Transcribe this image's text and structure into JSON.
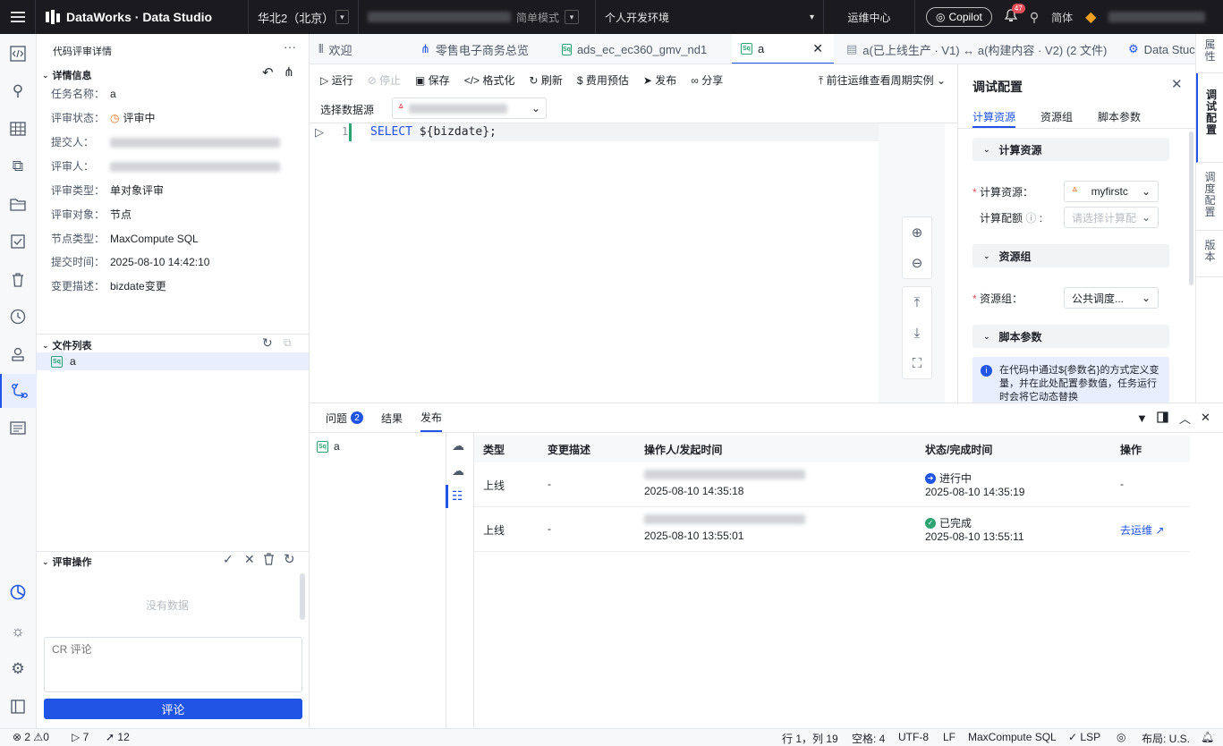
{
  "topbar": {
    "brand": "DataWorks · Data Studio",
    "region": "华北2（北京）",
    "mode": "简单模式",
    "env": "个人开发环境",
    "ops_center": "运维中心",
    "copilot": "Copilot",
    "notif_count": "47",
    "lang": "简体"
  },
  "review": {
    "title": "代码评审详情",
    "section_info": "详情信息",
    "fields": [
      {
        "k": "任务名称：",
        "v": "a"
      },
      {
        "k": "评审状态：",
        "v": "评审中"
      },
      {
        "k": "提交人：",
        "v": ""
      },
      {
        "k": "评审人：",
        "v": ""
      },
      {
        "k": "评审类型：",
        "v": "单对象评审"
      },
      {
        "k": "评审对象：",
        "v": "节点"
      },
      {
        "k": "节点类型：",
        "v": "MaxCompute SQL"
      },
      {
        "k": "提交时间：",
        "v": "2025-08-10 14:42:10"
      },
      {
        "k": "变更描述：",
        "v": "bizdate变更"
      }
    ],
    "section_files": "文件列表",
    "file_name": "a",
    "section_ops": "评审操作",
    "no_data": "没有数据",
    "comment_placeholder": "CR 评论",
    "comment_btn": "评论"
  },
  "tabs": [
    {
      "label": "欢迎"
    },
    {
      "label": "零售电子商务总览"
    },
    {
      "label": "ads_ec_ec360_gmv_nd1"
    },
    {
      "label": "a"
    },
    {
      "label": "a(已上线生产 · V1) ↔ a(构建内容 · V2) (2 文件)"
    },
    {
      "label": "Data Stuc"
    }
  ],
  "toolbar": {
    "run": "运行",
    "stop": "停止",
    "save": "保存",
    "format": "格式化",
    "refresh": "刷新",
    "cost": "费用预估",
    "publish": "发布",
    "share": "分享",
    "goto_ops": "前往运维查看周期实例"
  },
  "datasource_label": "选择数据源",
  "editor": {
    "line_no": "1",
    "code_kw": "SELECT",
    "code_rest": " ${bizdate};"
  },
  "debug": {
    "title": "调试配置",
    "tabs": [
      "计算资源",
      "资源组",
      "脚本参数"
    ],
    "grp_compute": "计算资源",
    "compute_label": "计算资源：",
    "compute_value": "myfirstc",
    "quota_label": "计算配额",
    "quota_placeholder": "请选择计算配",
    "grp_resource": "资源组",
    "resource_label": "资源组：",
    "resource_value": "公共调度...",
    "grp_params": "脚本参数",
    "info": "在代码中通过${参数名}的方式定义变量，并在此处配置参数值，任务运行时会将它动态替换"
  },
  "side_tabs": [
    "属性",
    "调试配置",
    "调度配置",
    "版本"
  ],
  "bottom": {
    "tab_issues": "问题",
    "issues_count": "2",
    "tab_results": "结果",
    "tab_publish": "发布",
    "file": "a",
    "headers": [
      "类型",
      "变更描述",
      "操作人/发起时间",
      "状态/完成时间",
      "操作"
    ],
    "rows": [
      {
        "type": "上线",
        "desc": "-",
        "time": "2025-08-10 14:35:18",
        "status": "进行中",
        "done": "2025-08-10 14:35:19",
        "op": "-"
      },
      {
        "type": "上线",
        "desc": "-",
        "time": "2025-08-10 13:55:01",
        "status": "已完成",
        "done": "2025-08-10 13:55:11",
        "op": "去运维 ↗"
      }
    ]
  },
  "statusbar": {
    "errors": "2",
    "warnings": "0",
    "runs": "7",
    "sends": "12",
    "pos": "行 1，列 19",
    "spaces": "空格: 4",
    "enc": "UTF-8",
    "eol": "LF",
    "lang": "MaxCompute SQL",
    "lsp": "✓ LSP",
    "layout": "布局: U.S."
  },
  "colors": {
    "accent": "#1f54e5",
    "success": "#2ba471",
    "warn": "#e37318",
    "topbar": "#1b1b1f"
  }
}
